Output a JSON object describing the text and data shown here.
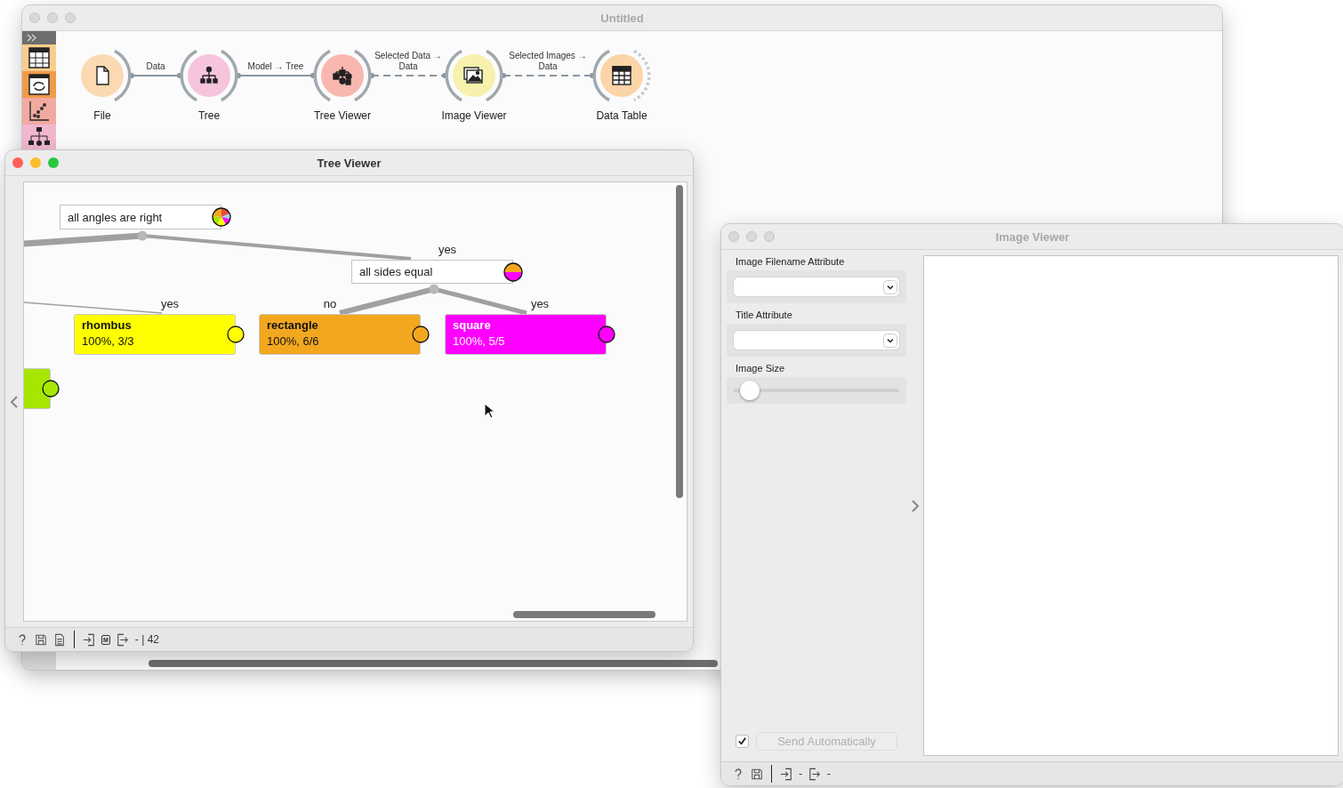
{
  "workflow_window": {
    "title": "Untitled",
    "active": false
  },
  "workflow": {
    "nodes": [
      {
        "label": "File",
        "color": "#fbd9b2"
      },
      {
        "label": "Tree",
        "color": "#f6c4dc"
      },
      {
        "label": "Tree Viewer",
        "color": "#f8b8b0"
      },
      {
        "label": "Image Viewer",
        "color": "#f6f1ac"
      },
      {
        "label": "Data Table",
        "color": "#fbd4a8"
      }
    ],
    "links": [
      {
        "label_lines": [
          "Data"
        ],
        "dashed": false
      },
      {
        "label_lines": [
          "Model → Tree"
        ],
        "dashed": false
      },
      {
        "label_lines": [
          "Selected Data →",
          "Data"
        ],
        "dashed": true
      },
      {
        "label_lines": [
          "Selected Images →",
          "Data"
        ],
        "dashed": true
      }
    ]
  },
  "tree_viewer": {
    "title": "Tree Viewer",
    "active": true,
    "tree": [
      {
        "kind": "split",
        "text": "all angles are right",
        "children": [
          {
            "kind": "split",
            "edge": "yes",
            "text": "all sides equal",
            "children": [
              {
                "kind": "leaf",
                "edge": "no",
                "title": "rectangle",
                "detail": "100%, 6/6",
                "color": "#f2a71f"
              },
              {
                "kind": "leaf",
                "edge": "yes",
                "title": "square",
                "detail": "100%, 5/5",
                "color": "#ff00ff"
              }
            ]
          }
        ]
      },
      {
        "kind": "leaf",
        "edge": "yes",
        "title": "rhombus",
        "detail": "100%, 3/3",
        "color": "#ffff00"
      },
      {
        "kind": "leaf",
        "color": "#a6e600"
      }
    ],
    "status": {
      "input_badge": "M",
      "output_summary": "- | 42"
    }
  },
  "image_viewer": {
    "title": "Image Viewer",
    "active": false,
    "fields": [
      {
        "label": "Image Filename Attribute"
      },
      {
        "label": "Title Attribute"
      }
    ],
    "image_size": {
      "label": "Image Size",
      "level": 0.06
    },
    "auto_send": {
      "checked": true,
      "label": "Send Automatically",
      "disabled": true
    },
    "status": {
      "input_summary": "-",
      "output_summary": "-"
    }
  }
}
